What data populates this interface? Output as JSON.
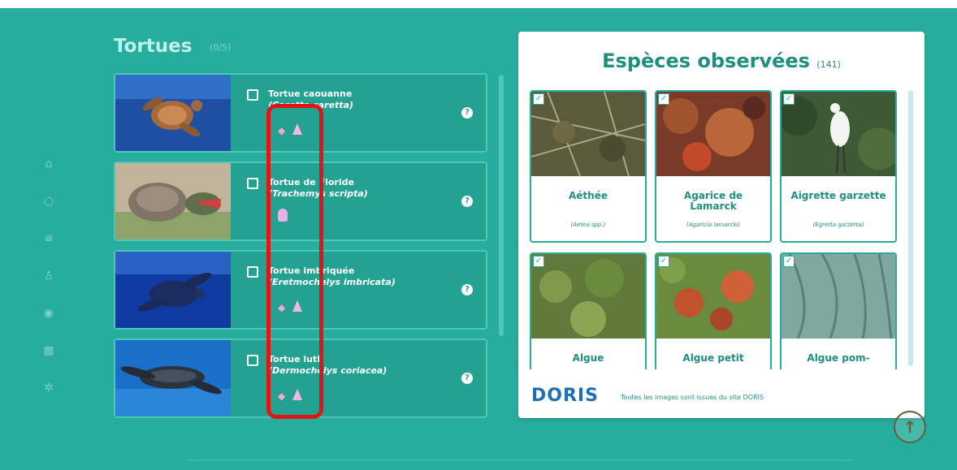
{
  "section": {
    "title": "Tortues",
    "count": "(0/5)"
  },
  "turtles": [
    {
      "name": "Tortue caouanne",
      "scientific": "(Caretta caretta)",
      "icons": [
        "fish-icon",
        "cone-icon"
      ]
    },
    {
      "name": "Tortue de Floride",
      "scientific": "(Trachemys scripta)",
      "icons": [
        "jellyfish-icon"
      ]
    },
    {
      "name": "Tortue imbriquée",
      "scientific": "(Eretmochelys imbricata)",
      "icons": [
        "fish-icon",
        "cone-icon"
      ]
    },
    {
      "name": "Tortue luth",
      "scientific": "(Dermochelys coriacea)",
      "icons": [
        "fish-icon",
        "cone-icon"
      ]
    }
  ],
  "species_panel": {
    "title": "Espèces observées",
    "count": "(141)",
    "cards": [
      {
        "name": "Aéthée",
        "scientific": "(Aetea spp.)"
      },
      {
        "name": "Agarice de Lamarck",
        "scientific": "(Agaricia lamarcki)"
      },
      {
        "name": "Aigrette garzette",
        "scientific": "(Egretta garzetta)"
      },
      {
        "name": "Algue",
        "scientific": ""
      },
      {
        "name": "Algue petit",
        "scientific": ""
      },
      {
        "name": "Algue pom-",
        "scientific": ""
      }
    ],
    "logo": "DORIS",
    "credit": "Toutes les images sont issues du site DORIS"
  },
  "info_glyph": "?",
  "checkmark_glyph": "✓",
  "up_glyph": "↑",
  "colors": {
    "background": "#27ad9d",
    "panel": "#ffffff",
    "highlight": "#e01515",
    "title": "#1f8f82"
  }
}
